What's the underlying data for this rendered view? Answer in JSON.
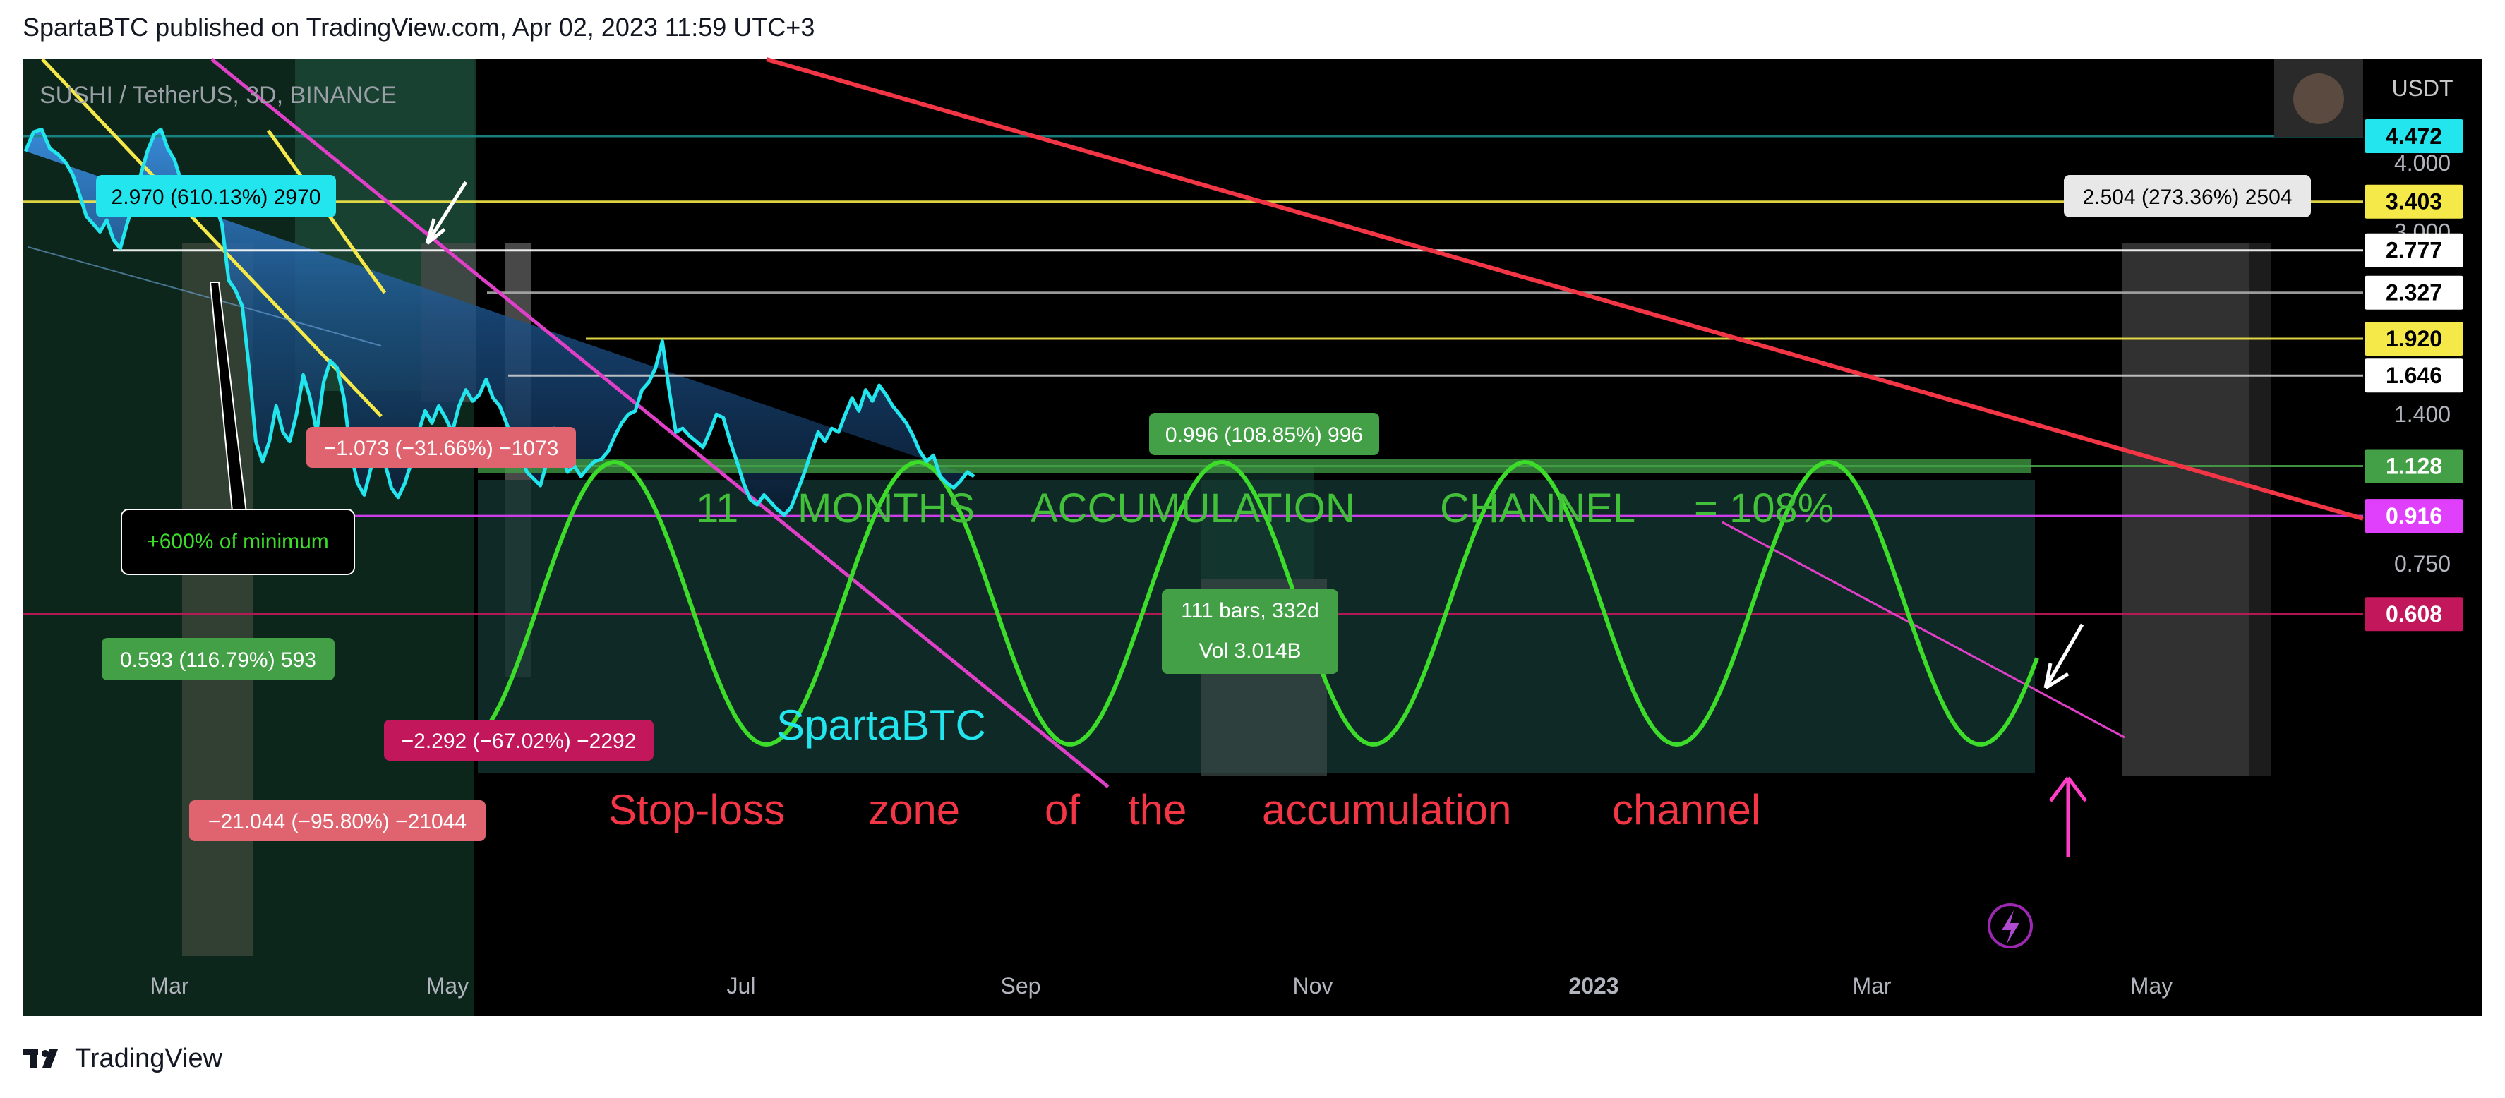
{
  "header": {
    "published": "SpartaBTC published on TradingView.com, Apr 02, 2023 11:59 UTC+3"
  },
  "footer": {
    "brand": "TradingView"
  },
  "colors": {
    "bg": "#000000",
    "price_line": "#22e5ee",
    "area_top": "#2f80d0",
    "sine": "#3ddc2a",
    "red_trend": "#f23645",
    "magenta": "#e040c8",
    "yellow": "#f5e94a",
    "white": "#ffffff",
    "label_red": "#e06470",
    "label_green": "#43a047",
    "label_crimson": "#c2185b"
  },
  "chart_data": {
    "type": "line",
    "symbol": "SUSHI / TetherUS, 3D, BINANCE",
    "currency": "USDT",
    "x_ticks": [
      "Mar",
      "May",
      "Jul",
      "Sep",
      "Nov",
      "2023",
      "Mar",
      "May"
    ],
    "y_scale": "log",
    "y_ticks": [
      4.0,
      3.0,
      1.4,
      0.75
    ],
    "y_tick_labels": [
      "4.000",
      "3.000",
      "1.400",
      "0.750"
    ],
    "levels": [
      {
        "label": "4.472",
        "value": 4.472,
        "bg": "#22e5ee",
        "fg": "#000000",
        "line": "#1b8a8a"
      },
      {
        "label": "3.403",
        "value": 3.403,
        "bg": "#f5e94a",
        "fg": "#000000",
        "line": "#f5e94a"
      },
      {
        "label": "2.777",
        "value": 2.777,
        "bg": "#ffffff",
        "fg": "#000000",
        "line": "#ffffff"
      },
      {
        "label": "2.327",
        "value": 2.327,
        "bg": "#ffffff",
        "fg": "#000000",
        "line": "#aaaaaa"
      },
      {
        "label": "1.920",
        "value": 1.92,
        "bg": "#f5e94a",
        "fg": "#000000",
        "line": "#f5e94a"
      },
      {
        "label": "1.646",
        "value": 1.646,
        "bg": "#ffffff",
        "fg": "#000000",
        "line": "#cccccc"
      },
      {
        "label": "1.128",
        "value": 1.128,
        "bg": "#43a047",
        "fg": "#ffffff",
        "line": "#43a047"
      },
      {
        "label": "0.916",
        "value": 0.916,
        "bg": "#e040fb",
        "fg": "#ffffff",
        "line": "#e040fb"
      },
      {
        "label": "0.608",
        "value": 0.608,
        "bg": "#c2185b",
        "fg": "#ffffff",
        "line": "#c2185b"
      }
    ],
    "price": {
      "t": [
        0,
        0.6,
        1.2,
        1.8,
        2.4,
        3,
        3.5,
        4,
        4.5,
        5,
        5.5,
        6,
        6.5,
        7,
        7.5,
        8,
        8.5,
        9,
        9.5,
        10,
        10.5,
        11,
        11.5,
        12,
        12.5,
        13,
        13.5,
        14,
        14.5,
        15,
        15.5,
        16,
        16.5,
        17,
        17.5,
        18,
        18.5,
        19,
        19.5,
        20,
        20.5,
        21,
        21.5,
        22,
        22.5,
        23,
        23.5,
        24,
        24.5,
        25,
        25.5,
        26,
        26.5,
        27,
        27.5,
        28,
        28.5,
        29,
        29.5,
        30,
        30.5,
        31,
        31.5,
        32,
        32.5,
        33,
        33.5,
        34,
        34.5,
        35,
        35.5,
        36,
        36.5,
        37,
        37.5,
        38,
        38.5,
        39,
        39.5,
        40,
        40.5,
        41,
        41.5,
        42,
        42.5,
        43,
        43.5,
        44,
        44.5,
        45,
        45.5,
        46,
        46.5,
        47,
        47.5,
        48,
        48.5,
        49,
        49.5,
        50,
        50.5,
        51,
        51.5,
        52,
        52.5,
        53,
        53.5,
        54,
        54.5,
        55,
        55.5,
        56,
        56.5,
        57,
        57.5,
        58,
        58.5,
        59,
        59.5,
        60,
        60.5,
        61,
        61.5,
        62,
        62.5,
        63,
        63.5,
        64,
        64.5,
        65,
        65.5,
        66,
        66.5,
        67,
        67.5,
        68,
        68.5,
        69,
        69.5,
        70,
        70.5,
        71,
        71.5,
        72,
        72.5,
        73,
        73.5,
        74,
        74.5,
        75,
        75.5,
        76,
        76.5,
        77,
        77.5,
        78,
        78.5,
        79,
        79.5,
        80,
        80.5,
        81,
        81.5,
        82,
        82.5,
        83,
        83.5,
        84,
        84.5,
        85,
        85.5,
        86,
        86.5,
        87,
        87.5,
        88,
        88.5,
        89,
        89.5,
        90,
        90.5,
        91,
        91.5,
        92,
        92.5,
        93,
        93.5,
        94,
        94.5,
        95,
        95.5,
        96,
        96.5,
        97,
        97.5,
        98,
        98.5,
        99,
        99.5,
        100,
        100.5,
        101,
        101.5,
        102,
        102.5,
        103,
        103.5,
        104,
        104.5,
        105,
        105.5,
        106,
        106.5,
        107,
        107.5,
        108,
        108.5,
        109,
        109.5,
        110
      ],
      "v": [
        4.2,
        4.55,
        4.6,
        4.25,
        4.15,
        4.0,
        3.8,
        3.5,
        3.2,
        3.1,
        3.0,
        3.15,
        2.9,
        2.8,
        3.1,
        3.4,
        3.8,
        4.2,
        4.5,
        4.6,
        4.25,
        4.05,
        3.7,
        3.3,
        3.2,
        3.25,
        3.4,
        3.35,
        3.1,
        2.45,
        2.35,
        2.2,
        1.7,
        1.25,
        1.15,
        1.25,
        1.45,
        1.3,
        1.25,
        1.4,
        1.65,
        1.5,
        1.3,
        1.6,
        1.75,
        1.7,
        1.5,
        1.2,
        1.05,
        1.0,
        1.12,
        1.22,
        1.15,
        1.03,
        0.99,
        1.05,
        1.15,
        1.3,
        1.42,
        1.35,
        1.45,
        1.38,
        1.3,
        1.45,
        1.55,
        1.48,
        1.52,
        1.62,
        1.5,
        1.45,
        1.35,
        1.25,
        1.2,
        1.1,
        1.07,
        1.04,
        1.15,
        1.32,
        1.2,
        1.1,
        1.13,
        1.08,
        1.12,
        1.15,
        1.16,
        1.2,
        1.28,
        1.35,
        1.4,
        1.42,
        1.55,
        1.6,
        1.7,
        1.9,
        1.55,
        1.3,
        1.32,
        1.28,
        1.25,
        1.22,
        1.3,
        1.4,
        1.38,
        1.25,
        1.15,
        1.05,
        0.98,
        0.96,
        1.0,
        0.97,
        0.94,
        0.92,
        0.95,
        1.02,
        1.1,
        1.2,
        1.3,
        1.25,
        1.32,
        1.3,
        1.4,
        1.5,
        1.42,
        1.55,
        1.48,
        1.58,
        1.52,
        1.45,
        1.4,
        1.35,
        1.28,
        1.2,
        1.15,
        1.18,
        1.08,
        1.05,
        1.03,
        1.06,
        1.1,
        1.08
      ],
      "t_end": 67.5
    },
    "annotations": {
      "labels": {
        "a1": "2.970 (610.13%) 2970",
        "a2": "−1.073 (−31.66%) −1073",
        "a3": "0.996 (108.85%) 996",
        "a4": "0.593 (116.79%) 593",
        "a5": "−2.292 (−67.02%) −2292",
        "a6": "−21.044 (−95.80%) −21044",
        "a7": "2.504 (273.36%) 2504",
        "bars": "111 bars, 332d",
        "vol": "Vol 3.014B",
        "min_note": "+600% of minimum"
      },
      "channel_text": [
        "11",
        "MONTHS",
        "ACCUMULATION",
        "CHANNEL",
        "= 108%"
      ],
      "stoploss_text": [
        "Stop-loss",
        "zone",
        "of",
        "the",
        "accumulation",
        "channel"
      ],
      "author": "SpartaBTC"
    }
  }
}
